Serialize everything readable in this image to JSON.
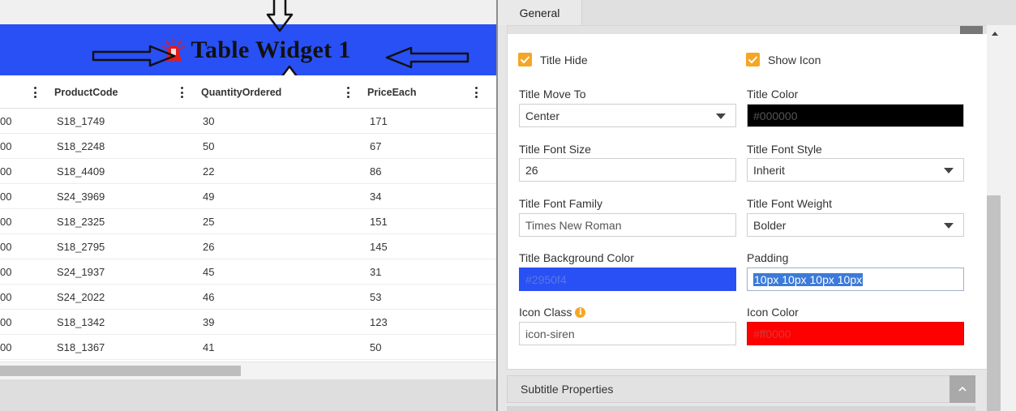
{
  "widget": {
    "title": "Table Widget 1",
    "icon": "siren-icon",
    "background": "#2950f4"
  },
  "table": {
    "columns": [
      "ProductCode",
      "QuantityOrdered",
      "PriceEach"
    ],
    "rows": [
      [
        "00",
        "S18_1749",
        "30",
        "171"
      ],
      [
        "00",
        "S18_2248",
        "50",
        "67"
      ],
      [
        "00",
        "S18_4409",
        "22",
        "86"
      ],
      [
        "00",
        "S24_3969",
        "49",
        "34"
      ],
      [
        "00",
        "S18_2325",
        "25",
        "151"
      ],
      [
        "00",
        "S18_2795",
        "26",
        "145"
      ],
      [
        "00",
        "S24_1937",
        "45",
        "31"
      ],
      [
        "00",
        "S24_2022",
        "46",
        "53"
      ],
      [
        "00",
        "S18_1342",
        "39",
        "123"
      ],
      [
        "00",
        "S18_1367",
        "41",
        "50"
      ]
    ]
  },
  "settings": {
    "tab": "General",
    "title_hide": {
      "label": "Title Hide",
      "checked": true
    },
    "show_icon": {
      "label": "Show Icon",
      "checked": true
    },
    "title_move_to": {
      "label": "Title Move To",
      "value": "Center"
    },
    "title_color": {
      "label": "Title Color",
      "value": "#000000"
    },
    "title_font_size": {
      "label": "Title Font Size",
      "value": "26"
    },
    "title_font_style": {
      "label": "Title Font Style",
      "value": "Inherit"
    },
    "title_font_family": {
      "label": "Title Font Family",
      "value": "Times New Roman"
    },
    "title_font_weight": {
      "label": "Title Font Weight",
      "value": "Bolder"
    },
    "title_bg_color": {
      "label": "Title Background Color",
      "value": "#2950f4"
    },
    "padding": {
      "label": "Padding",
      "value": "10px 10px 10px 10px"
    },
    "icon_class": {
      "label": "Icon Class",
      "value": "icon-siren"
    },
    "icon_color": {
      "label": "Icon Color",
      "value": "#ff0000"
    },
    "subtitle_section": "Subtitle Properties"
  },
  "colors": {
    "accent_checkbox": "#f5a623",
    "title_bar": "#2950f4",
    "title_color_swatch": "#000000",
    "icon_color_swatch": "#ff0000"
  }
}
